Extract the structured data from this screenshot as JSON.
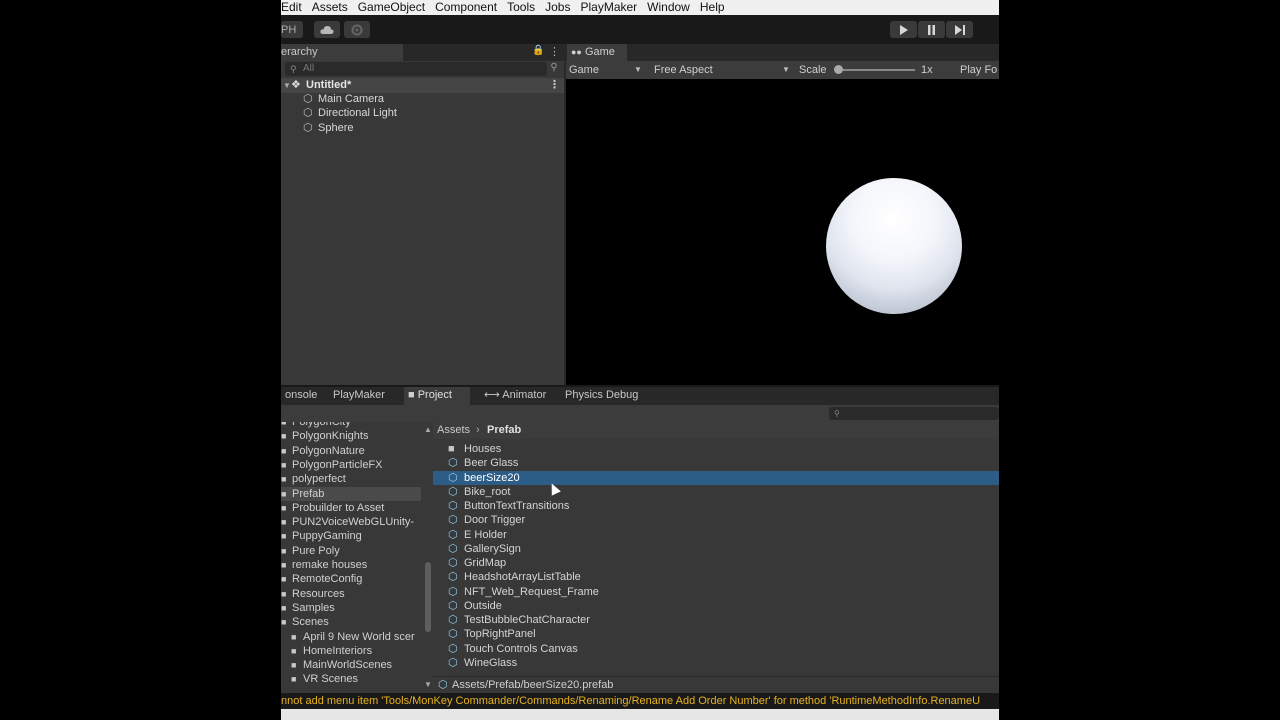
{
  "menubar": {
    "items": [
      "Edit",
      "Assets",
      "GameObject",
      "Component",
      "Tools",
      "Jobs",
      "PlayMaker",
      "Window",
      "Help"
    ]
  },
  "toolbar": {
    "account_label": "PH",
    "icons": [
      "cloud-icon",
      "gear-icon",
      "play-icon",
      "pause-icon",
      "step-icon"
    ]
  },
  "hierarchy": {
    "tab_label": "erarchy",
    "search_placeholder": "All",
    "scene_name": "Untitled*",
    "items": [
      "Main Camera",
      "Directional Light",
      "Sphere"
    ]
  },
  "game": {
    "tab_label": "Game",
    "display": "Game",
    "aspect": "Free Aspect",
    "scale_label": "Scale",
    "scale_value": "1x",
    "play_focused": "Play Fo"
  },
  "bottom_tabs": {
    "console": "onsole",
    "playmaker": "PlayMaker",
    "project": "Project",
    "animator": "Animator",
    "physics": "Physics Debug"
  },
  "folder_tree": {
    "items": [
      {
        "label": "PolygonCity",
        "sub": false,
        "selected": false
      },
      {
        "label": "PolygonKnights",
        "sub": false,
        "selected": false
      },
      {
        "label": "PolygonNature",
        "sub": false,
        "selected": false
      },
      {
        "label": "PolygonParticleFX",
        "sub": false,
        "selected": false
      },
      {
        "label": "polyperfect",
        "sub": false,
        "selected": false
      },
      {
        "label": "Prefab",
        "sub": false,
        "selected": true
      },
      {
        "label": "Probuilder to Asset",
        "sub": false,
        "selected": false
      },
      {
        "label": "PUN2VoiceWebGLUnity-",
        "sub": false,
        "selected": false
      },
      {
        "label": "PuppyGaming",
        "sub": false,
        "selected": false
      },
      {
        "label": "Pure Poly",
        "sub": false,
        "selected": false
      },
      {
        "label": "remake houses",
        "sub": false,
        "selected": false
      },
      {
        "label": "RemoteConfig",
        "sub": false,
        "selected": false
      },
      {
        "label": "Resources",
        "sub": false,
        "selected": false
      },
      {
        "label": "Samples",
        "sub": false,
        "selected": false
      },
      {
        "label": "Scenes",
        "sub": false,
        "selected": false
      },
      {
        "label": "April 9 New World scer",
        "sub": true,
        "selected": false
      },
      {
        "label": "HomeInteriors",
        "sub": true,
        "selected": false
      },
      {
        "label": "MainWorldScenes",
        "sub": true,
        "selected": false
      },
      {
        "label": "VR Scenes",
        "sub": true,
        "selected": false
      }
    ]
  },
  "breadcrumb": {
    "root": "Assets",
    "current": "Prefab"
  },
  "assets": [
    {
      "label": "Houses",
      "type": "folder",
      "selected": false
    },
    {
      "label": "Beer Glass",
      "type": "prefab",
      "selected": false
    },
    {
      "label": "beerSize20",
      "type": "prefab",
      "selected": true
    },
    {
      "label": "Bike_root",
      "type": "prefab",
      "selected": false
    },
    {
      "label": "ButtonTextTransitions",
      "type": "prefab",
      "selected": false
    },
    {
      "label": "Door Trigger",
      "type": "prefab",
      "selected": false
    },
    {
      "label": "E Holder",
      "type": "prefab",
      "selected": false
    },
    {
      "label": "GallerySign",
      "type": "prefab",
      "selected": false
    },
    {
      "label": "GridMap",
      "type": "prefab",
      "selected": false
    },
    {
      "label": "HeadshotArrayListTable",
      "type": "prefab",
      "selected": false
    },
    {
      "label": "NFT_Web_Request_Frame",
      "type": "prefab",
      "selected": false
    },
    {
      "label": "Outside",
      "type": "prefab",
      "selected": false
    },
    {
      "label": "TestBubbleChatCharacter",
      "type": "prefab",
      "selected": false
    },
    {
      "label": "TopRightPanel",
      "type": "prefab",
      "selected": false
    },
    {
      "label": "Touch Controls Canvas",
      "type": "prefab",
      "selected": false
    },
    {
      "label": "WineGlass",
      "type": "prefab",
      "selected": false
    }
  ],
  "asset_path": "Assets/Prefab/beerSize20.prefab",
  "status": "nnot add menu item 'Tools/MonKey Commander/Commands/Renaming/Rename Add Order Number' for method 'RuntimeMethodInfo.RenameU",
  "colors": {
    "selection": "#2c5d87",
    "prefab_icon": "#8ec9ef",
    "warning_text": "#e8b21f"
  }
}
